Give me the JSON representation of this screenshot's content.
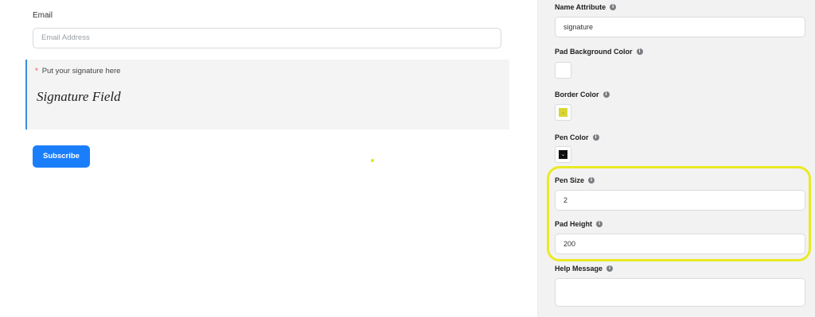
{
  "form": {
    "email_label": "Email",
    "email_placeholder": "Email Address",
    "signature_required_mark": "*",
    "signature_label": "Put your signature here",
    "signature_text": "Signature Field",
    "subscribe_label": "Subscribe"
  },
  "settings": {
    "name_attribute": {
      "label": "Name Attribute",
      "value": "signature"
    },
    "pad_background_color": {
      "label": "Pad Background Color",
      "color": "#ffffff"
    },
    "border_color": {
      "label": "Border Color",
      "color": "#d9d633"
    },
    "pen_color": {
      "label": "Pen Color",
      "color": "#111111"
    },
    "pen_size": {
      "label": "Pen Size",
      "value": "2"
    },
    "pad_height": {
      "label": "Pad Height",
      "value": "200"
    },
    "help_message": {
      "label": "Help Message",
      "value": ""
    }
  },
  "colors": {
    "accent": "#1a7efb",
    "signature_border": "#3e8dd8",
    "highlight": "#eaea23",
    "required": "#f0443a"
  },
  "icons": {
    "info": "info-icon",
    "chevron": "chevron-down-icon"
  }
}
